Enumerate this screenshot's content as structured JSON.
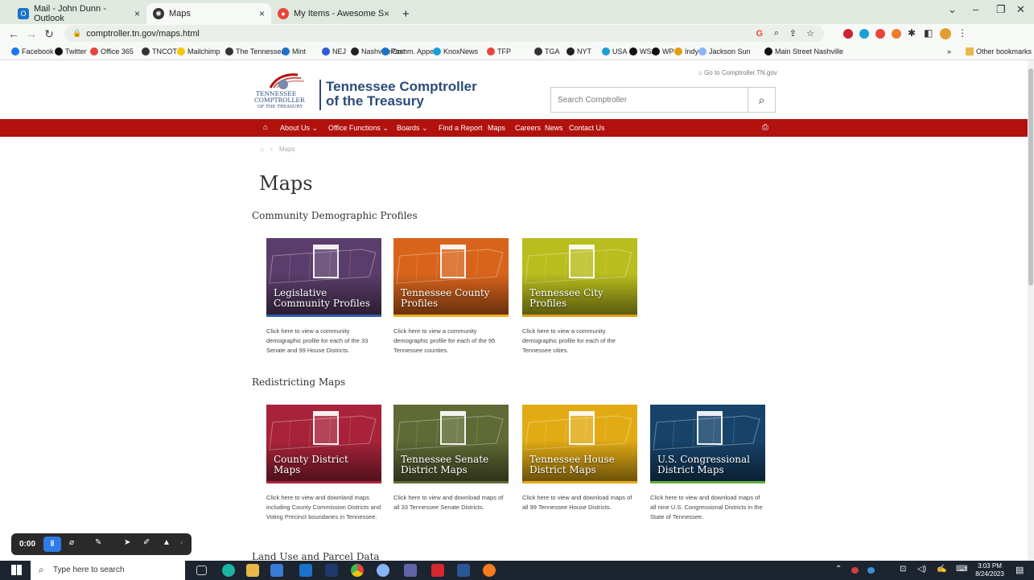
{
  "browser": {
    "tabs": [
      {
        "label": "Mail - John Dunn - Outlook",
        "icon": "outlook-icon",
        "color": "#1a73c9"
      },
      {
        "label": "Maps",
        "icon": "tn-seal-icon",
        "color": "#333333"
      },
      {
        "label": "My Items - Awesome Screenshot",
        "icon": "awesome-screenshot-icon",
        "color": "#e8453c"
      }
    ],
    "url": "comptroller.tn.gov/maps.html",
    "bookmarks": [
      "Facebook",
      "Twitter",
      "Office 365",
      "TNCOT",
      "Mailchimp",
      "The Tennessean",
      "Mint",
      "NEJ",
      "NashvillePost",
      "Comm. Appeal",
      "KnoxNews",
      "TFP",
      "TGA",
      "NYT",
      "USA",
      "WSJ",
      "WP",
      "Indy",
      "Jackson Sun",
      "Main Street Nashville"
    ],
    "bookmark_tn_prefix": "TN",
    "bookmark_wsj_prefix": "WJ",
    "bookmark_wp_prefix": "Wp",
    "bookmark_msn_prefix": "M",
    "other_bookmarks": "Other bookmarks",
    "more_bookmarks": "»"
  },
  "site": {
    "logo_line1": "TENNESSEE",
    "logo_line2": "COMPTROLLER",
    "logo_line3": "OF THE TREASURY",
    "title_line1": "Tennessee Comptroller",
    "title_line2": "of the Treasury",
    "go_link": "Go to Comptroller.TN.gov",
    "search_placeholder": "Search Comptroller",
    "accent_color": "#b1120e",
    "menu": [
      "About Us",
      "Office Functions",
      "Boards",
      "Find a Report",
      "Maps",
      "Careers",
      "News",
      "Contact Us"
    ],
    "breadcrumb": "Maps",
    "page_title": "Maps",
    "sections": [
      {
        "heading": "Community Demographic Profiles",
        "cards": [
          {
            "label": "Legislative Community Profiles",
            "color": "#5b3d6b",
            "stripe": "#2f5da8",
            "icon": "capitol-icon",
            "desc": "Click here to view a community demographic profile for each of the 33 Senate and 99 House Districts."
          },
          {
            "label": "Tennessee County Profiles",
            "color": "#d8641b",
            "stripe": "#f0b020",
            "icon": "magnifier-icon",
            "desc": "Click here to view a community demographic profile for each of the 95 Tennessee counties."
          },
          {
            "label": "Tennessee City Profiles",
            "color": "#b9bd1d",
            "stripe": "#e39b1b",
            "icon": "city-buildings-icon",
            "desc": "Click here to view a community demographic profile for each of the Tennessee cities."
          }
        ]
      },
      {
        "heading": "Redistricting Maps",
        "cards": [
          {
            "label": "County District Maps",
            "color": "#a8233a",
            "stripe": "#a8233a",
            "icon": "courthouse-icon",
            "desc": "Click here to view and downland maps including County Commission Districts and Voting Precinct boundaries in Tennessee."
          },
          {
            "label": "Tennessee Senate District Maps",
            "color": "#5f6a35",
            "stripe": "#5f6a35",
            "icon": "senate-building-icon",
            "desc": "Click here to view and download maps of all 33 Tennessee Senate Districts."
          },
          {
            "label": "Tennessee House District Maps",
            "color": "#e2ab14",
            "stripe": "#e2ab14",
            "icon": "house-building-icon",
            "desc": "Click here to view and download maps of all 99 Tennessee House Districts."
          },
          {
            "label": "U.S. Congressional District Maps",
            "color": "#17436b",
            "stripe": "#5fae3a",
            "icon": "us-capitol-icon",
            "desc": "Click here to view and download maps of all nine U.S. Congressional Districts in the State of Tennessee."
          }
        ]
      }
    ],
    "next_heading": "Land Use and Parcel Data"
  },
  "recorder": {
    "time": "0:00"
  },
  "taskbar": {
    "search_placeholder": "Type here to search",
    "time": "3:03 PM",
    "date": "8/24/2023"
  }
}
